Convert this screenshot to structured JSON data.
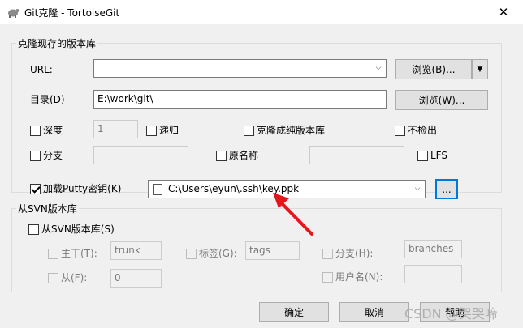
{
  "window": {
    "title": "Git克隆 - TortoiseGit",
    "close_glyph": "✕"
  },
  "repo_group": {
    "title": "克隆现存的版本库",
    "url_label": "URL:",
    "url_value": "",
    "browse_url_label": "浏览(B)...",
    "dir_label": "目录(D)",
    "dir_value": "E:\\work\\git\\",
    "browse_dir_label": "浏览(W)...",
    "depth_label": "深度",
    "depth_value": "1",
    "recursive_label": "递归",
    "bare_label": "克隆成纯版本库",
    "no_checkout_label": "不检出",
    "branch_label": "分支",
    "branch_value": "",
    "origin_label": "原名称",
    "origin_value": "",
    "lfs_label": "LFS"
  },
  "putty": {
    "load_label": "加载Putty密钥(K)",
    "key_path": "C:\\Users\\eyun\\.ssh\\key.ppk",
    "browse_label": "..."
  },
  "svn_group": {
    "title": "从SVN版本库",
    "from_svn_label": "从SVN版本库(S)",
    "trunk_label": "主干(T):",
    "trunk_value": "trunk",
    "tags_label": "标签(G):",
    "tags_value": "tags",
    "branches_label": "分支(H):",
    "branches_value": "branches",
    "from_label": "从(F):",
    "from_value": "0",
    "username_label": "用户名(N):",
    "username_value": ""
  },
  "buttons": {
    "ok": "确定",
    "cancel": "取消",
    "help": "帮助"
  },
  "watermark": "CSDN @哭哭啼",
  "colors": {
    "accent": "#0078d7",
    "arrow": "#e8141b"
  }
}
